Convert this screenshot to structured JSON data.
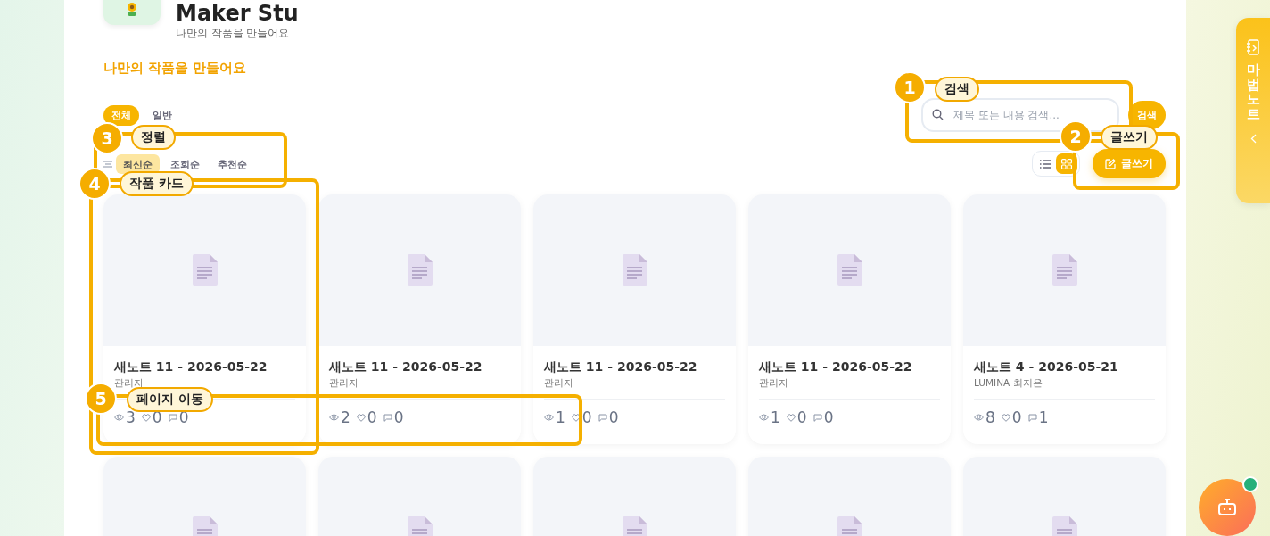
{
  "header": {
    "title": "Maker Stu",
    "subtitle": "나만의 작품을 만들어요"
  },
  "heading": "나만의 작품을 만들어요",
  "category_tabs": [
    {
      "label": "전체",
      "selected": true
    },
    {
      "label": "일반",
      "selected": false
    }
  ],
  "sort_options": [
    {
      "label": "최신순",
      "selected": true
    },
    {
      "label": "조회순",
      "selected": false
    },
    {
      "label": "추천순",
      "selected": false
    }
  ],
  "search": {
    "placeholder": "제목 또는 내용 검색...",
    "button": "검색"
  },
  "view_modes": [
    {
      "kind": "list",
      "selected": false
    },
    {
      "kind": "grid",
      "selected": true
    }
  ],
  "write_button": "글쓰기",
  "cards": [
    {
      "kind": "full",
      "title": "새노트 11 - 2026-05-22",
      "author": "관리자",
      "views": "3",
      "likes": "0",
      "comments": "0"
    },
    {
      "kind": "full",
      "title": "새노트 11 - 2026-05-22",
      "author": "관리자",
      "views": "2",
      "likes": "0",
      "comments": "0"
    },
    {
      "kind": "full",
      "title": "새노트 11 - 2026-05-22",
      "author": "관리자",
      "views": "1",
      "likes": "0",
      "comments": "0"
    },
    {
      "kind": "full",
      "title": "새노트 11 - 2026-05-22",
      "author": "관리자",
      "views": "1",
      "likes": "0",
      "comments": "0"
    },
    {
      "kind": "full",
      "title": "새노트 4 - 2026-05-21",
      "author": "LUMINA 최지은",
      "views": "8",
      "likes": "0",
      "comments": "1"
    },
    {
      "kind": "cut"
    },
    {
      "kind": "cut"
    },
    {
      "kind": "cut"
    },
    {
      "kind": "cut"
    },
    {
      "kind": "cut"
    }
  ],
  "tour": [
    {
      "number": "1",
      "label": "검색"
    },
    {
      "number": "3",
      "label": "정렬"
    },
    {
      "number": "2",
      "label": "글쓰기"
    },
    {
      "number": "4",
      "label": "작품 카드"
    },
    {
      "number": "5",
      "label": "페이지 이동"
    }
  ],
  "side_tab": {
    "label": "마법노트"
  },
  "assistant": {
    "online": true
  }
}
